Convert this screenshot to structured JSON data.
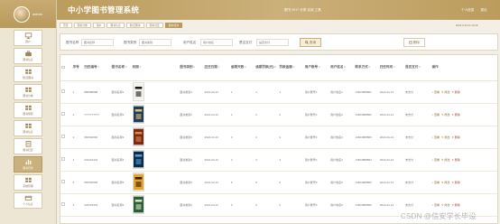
{
  "app": {
    "title": "中小学图书管理系统",
    "header_center": "图书 2017 分类 实用 工具",
    "header_links": [
      "个人信息",
      "退出"
    ],
    "datetime": "2024-9-23 21:10:18"
  },
  "sidebar": {
    "username": "admin",
    "items": [
      {
        "label": "用户",
        "icon": "monitor-icon"
      },
      {
        "label": "图书信息",
        "icon": "briefcase-icon"
      },
      {
        "label": "借/还图书",
        "icon": "grid-icon"
      },
      {
        "label": "图书分类",
        "icon": "grid-icon"
      },
      {
        "label": "图书借阅",
        "icon": "grid-icon"
      },
      {
        "label": "图书信息",
        "icon": "grid-icon"
      },
      {
        "label": "图书归还",
        "icon": "document-icon"
      },
      {
        "label": "图书罚款",
        "icon": "bar-chart-icon"
      },
      {
        "label": "系统管理",
        "icon": "grid-icon"
      },
      {
        "label": "个人信息",
        "icon": "card-icon"
      }
    ],
    "active_index": 7
  },
  "breadcrumbs": [
    "首页",
    "图书分类",
    "用户",
    "图书信息",
    "借/还图书",
    "图书归还",
    "图书罚款"
  ],
  "breadcrumb_active": 6,
  "search": {
    "field1_label": "图书名称",
    "field1_placeholder": "图书名称",
    "field2_label": "图书类别",
    "field2_placeholder": "图书类别",
    "field3_label": "用户姓名",
    "field3_placeholder": "用户姓名",
    "field4_label": "是否支付",
    "field4_placeholder": "是否支付",
    "search_button": "查询",
    "delete_button": "删除"
  },
  "table": {
    "columns": [
      "序号",
      "归还编号",
      "图书名称",
      "封面",
      "图书类别",
      "应还日期",
      "逾期天数",
      "逾期罚款(元)",
      "罚款金额",
      "用户账号",
      "用户姓名",
      "联系方式",
      "归还时间",
      "是否支付",
      "操作"
    ],
    "op_detail": "查看",
    "op_edit": "修改",
    "op_delete": "删除",
    "rows": [
      {
        "no": "1",
        "code": "888888888",
        "name": "图书名称1",
        "category": "图书类别1",
        "due": "2024-04-13",
        "days": "1",
        "fine": "1",
        "amount": "1",
        "account": "用户账号1",
        "user": "用户姓名1",
        "phone": "13823888881",
        "time": "2024-04-13",
        "paid": "未支付"
      },
      {
        "no": "2",
        "code": "7777777777",
        "name": "图书名称2",
        "category": "图书类别2",
        "due": "2024-04-13",
        "days": "2",
        "fine": "2",
        "amount": "2",
        "account": "用户账号2",
        "user": "用户姓名2",
        "phone": "13823888882",
        "time": "2024-04-13",
        "paid": "未支付"
      },
      {
        "no": "3",
        "code": "666666666",
        "name": "图书名称3",
        "category": "图书类别3",
        "due": "2024-04-13",
        "days": "3",
        "fine": "3",
        "amount": "3",
        "account": "用户账号3",
        "user": "用户姓名3",
        "phone": "13823888883",
        "time": "2024-04-13",
        "paid": "未支付"
      },
      {
        "no": "4",
        "code": "444444444",
        "name": "图书名称4",
        "category": "图书类别4",
        "due": "2024-04-13",
        "days": "4",
        "fine": "4",
        "amount": "4",
        "account": "用户账号4",
        "user": "用户姓名4",
        "phone": "13823888884",
        "time": "2024-04-13",
        "paid": "未支付"
      },
      {
        "no": "5",
        "code": "555555555",
        "name": "图书名称5",
        "category": "图书类别5",
        "due": "2024-04-13",
        "days": "5",
        "fine": "5",
        "amount": "5",
        "account": "用户账号5",
        "user": "用户姓名5",
        "phone": "13823888885",
        "time": "2024-04-13",
        "paid": "未支付"
      },
      {
        "no": "6",
        "code": "333333333",
        "name": "图书名称6",
        "category": "图书类别6",
        "due": "2024-04-13",
        "days": "6",
        "fine": "6",
        "amount": "6",
        "account": "用户账号6",
        "user": "用户姓名6",
        "phone": "13823888886",
        "time": "2024-04-13",
        "paid": "未支付"
      }
    ]
  },
  "watermark": "CSDN @信安学长毕设",
  "colors": {
    "accent": "#b99a5b",
    "panel": "#ede6d4",
    "background": "#f4efe6"
  }
}
